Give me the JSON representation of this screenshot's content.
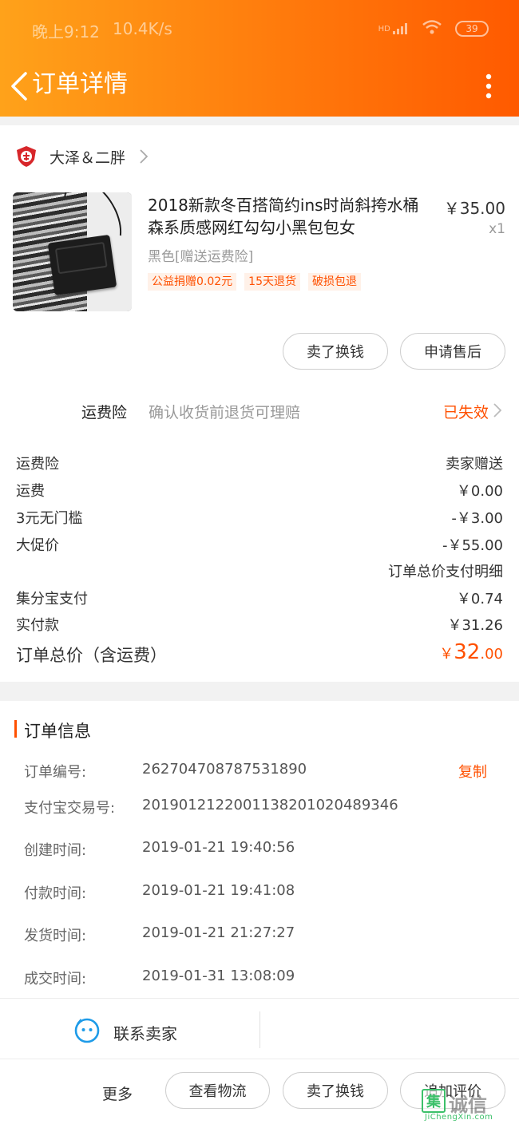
{
  "status_bar": {
    "time": "晚上9:12",
    "speed": "10.4K/s",
    "network": "HD",
    "battery": "39"
  },
  "nav": {
    "title": "订单详情"
  },
  "shop": {
    "name": "大泽＆二胖"
  },
  "product": {
    "title": "2018新款冬百搭简约ins时尚斜挎水桶森系质感网红勾勾小黑包包女",
    "price": "￥35.00",
    "qty": "x1",
    "variant": "黑色[赠送运费险]",
    "tags": [
      "公益捐赠0.02元",
      "15天退货",
      "破损包退"
    ]
  },
  "item_actions": {
    "sell": "卖了换钱",
    "aftersale": "申请售后"
  },
  "insurance": {
    "label": "运费险",
    "desc": "确认收货前退货可理赔",
    "status": "已失效"
  },
  "fees": [
    {
      "label": "运费险",
      "value": "卖家赠送"
    },
    {
      "label": "运费",
      "value": "￥0.00"
    },
    {
      "label": "3元无门槛",
      "value": "-￥3.00"
    },
    {
      "label": "大促价",
      "value": "-￥55.00"
    },
    {
      "label": "",
      "value": "订单总价支付明细"
    },
    {
      "label": "集分宝支付",
      "value": "￥0.74"
    },
    {
      "label": "实付款",
      "value": "￥31.26"
    }
  ],
  "total": {
    "label": "订单总价（含运费）",
    "currency": "￥",
    "integer": "32",
    "decimal": ".00"
  },
  "order_info": {
    "title": "订单信息",
    "copy_label": "复制",
    "rows": [
      {
        "label": "订单编号:",
        "value": "262704708787531890"
      },
      {
        "label": "支付宝交易号:",
        "value": "2019012122001138201020489346"
      },
      {
        "label": "创建时间:",
        "value": "2019-01-21 19:40:56"
      },
      {
        "label": "付款时间:",
        "value": "2019-01-21 19:41:08"
      },
      {
        "label": "发货时间:",
        "value": "2019-01-21 21:27:27"
      },
      {
        "label": "成交时间:",
        "value": "2019-01-31 13:08:09"
      }
    ]
  },
  "contact": {
    "label": "联系卖家"
  },
  "bottom": {
    "more": "更多",
    "logistics": "查看物流",
    "sell": "卖了换钱",
    "review": "追加评价"
  },
  "watermark": {
    "mark": "集",
    "text": "诚信",
    "url": "JiChengXin.com"
  },
  "colors": {
    "accent": "#ff5000",
    "header_start": "#ffa21a",
    "header_end": "#ff5a00"
  }
}
